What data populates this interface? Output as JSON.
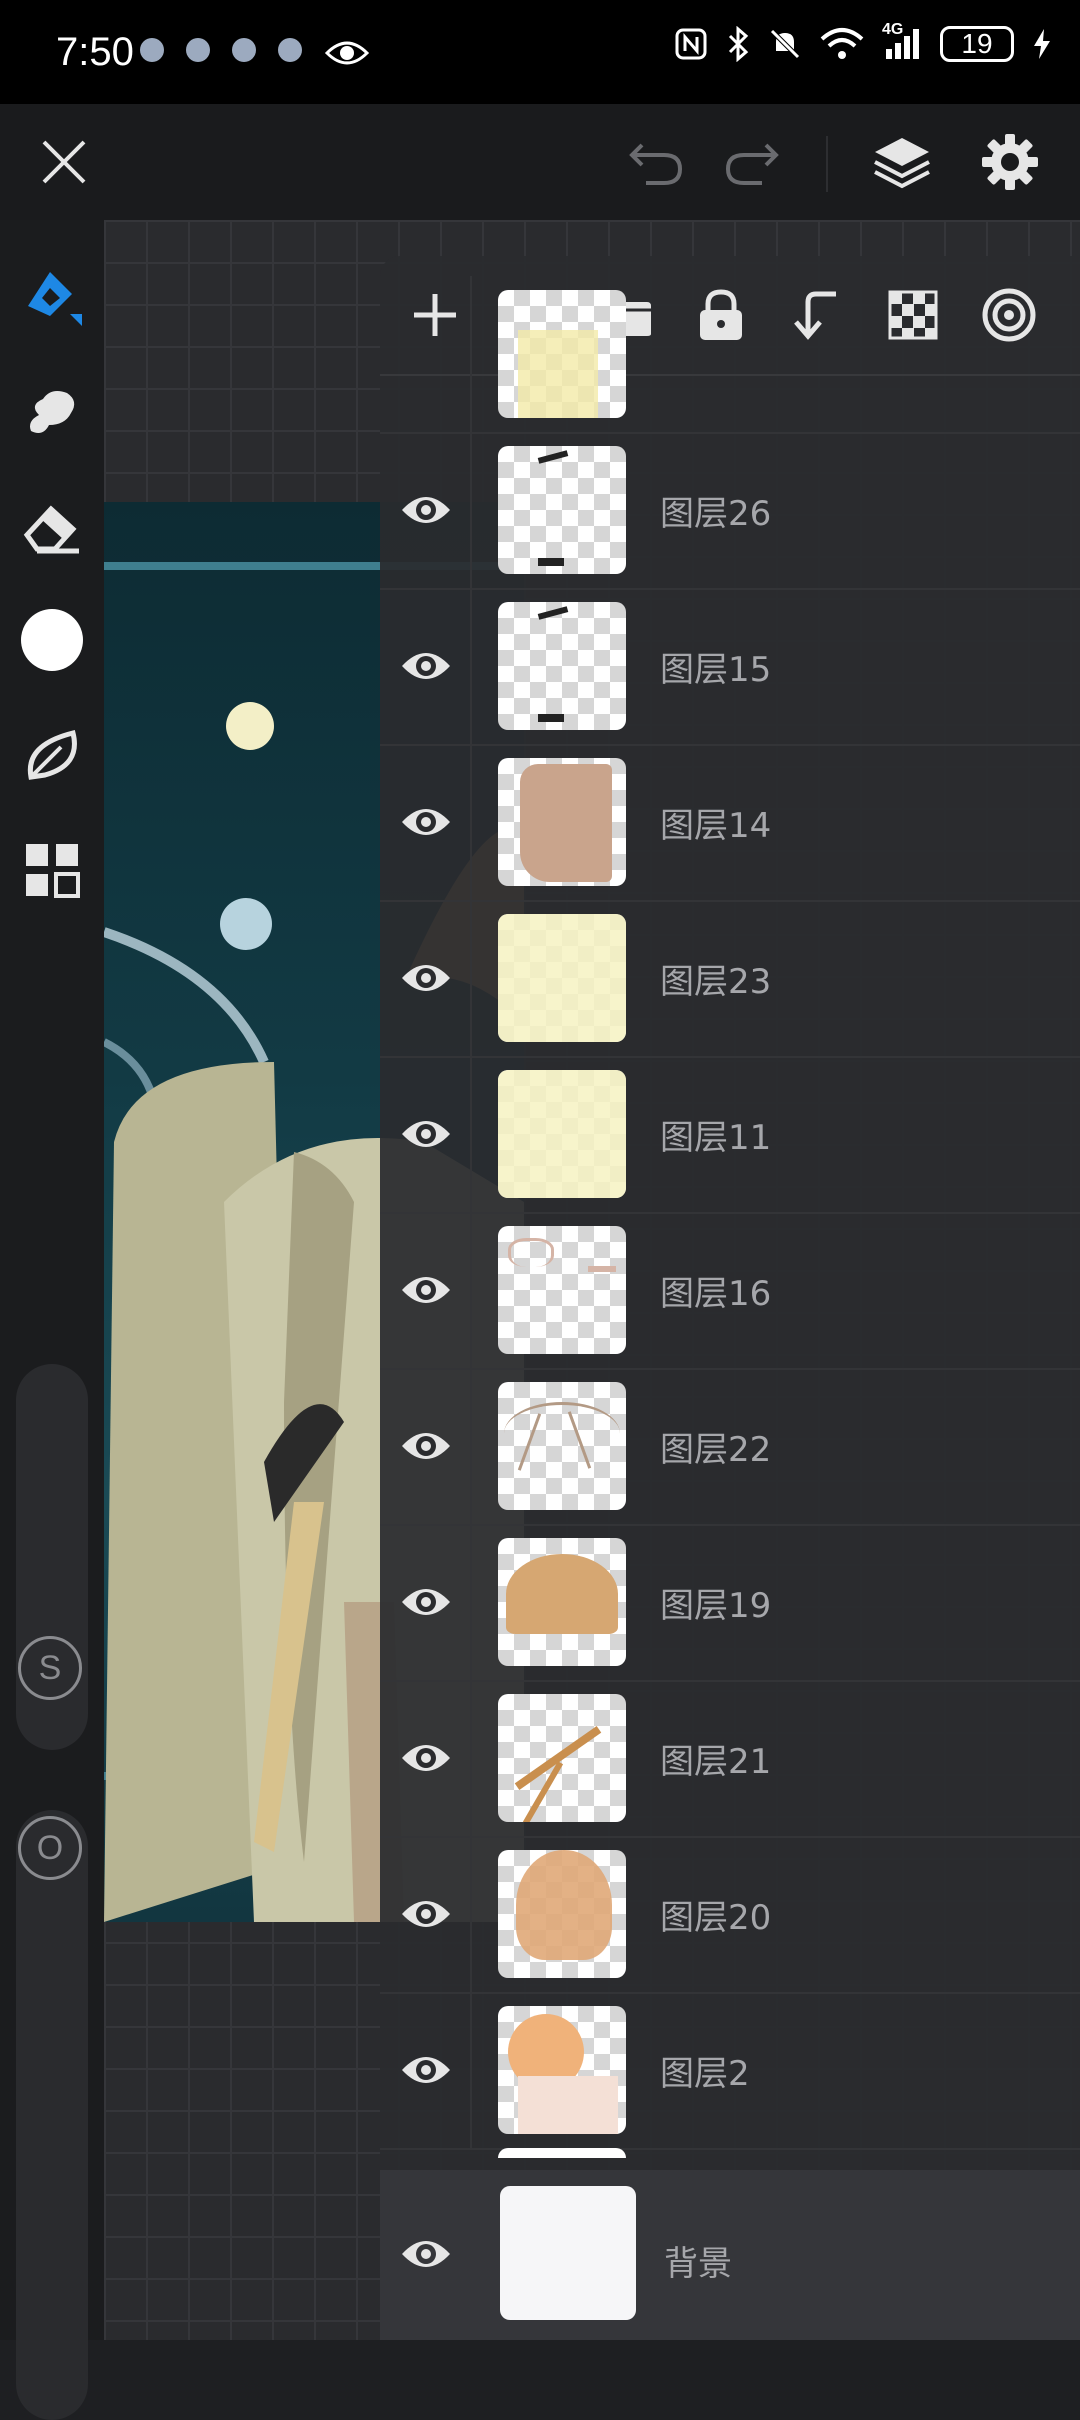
{
  "status_bar": {
    "time": "7:50",
    "network": "4G",
    "battery": "19"
  },
  "toolbar": {
    "close": "close",
    "undo": "undo",
    "redo": "redo",
    "layers": "layers",
    "settings": "settings"
  },
  "left_tools": {
    "size_label": "S",
    "opacity_label": "O"
  },
  "layers_panel": {
    "tools": [
      "add-layer",
      "folder",
      "lock",
      "merge-down",
      "transparency",
      "layer-mode"
    ],
    "layers": [
      {
        "name": "图层26",
        "thumb": "marks"
      },
      {
        "name": "图层15",
        "thumb": "marks"
      },
      {
        "name": "图层14",
        "thumb": "skin"
      },
      {
        "name": "图层23",
        "thumb": "yellow"
      },
      {
        "name": "图层11",
        "thumb": "yellow"
      },
      {
        "name": "图层16",
        "thumb": "lines"
      },
      {
        "name": "图层22",
        "thumb": "hairlines"
      },
      {
        "name": "图层19",
        "thumb": "hair"
      },
      {
        "name": "图层21",
        "thumb": "strokes"
      },
      {
        "name": "图层20",
        "thumb": "hair2"
      },
      {
        "name": "图层2",
        "thumb": "face"
      }
    ],
    "background_layer": "背景"
  },
  "colors": {
    "accent": "#1e88e5",
    "panel_bg": "#2a2b2e",
    "text": "#a6a7ab"
  }
}
